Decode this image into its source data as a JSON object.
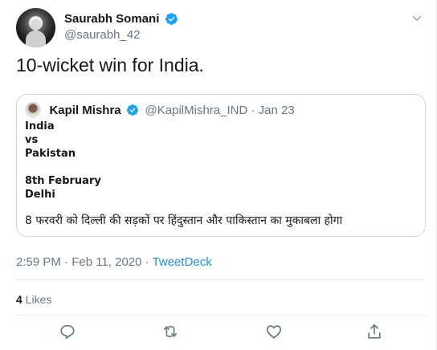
{
  "author": {
    "display_name": "Saurabh Somani",
    "handle": "@saurabh_42",
    "icons": {
      "verified": "verified-badge-icon",
      "more": "chevron-down-icon"
    }
  },
  "tweet": {
    "text": "10-wicket win for India."
  },
  "quoted_tweet": {
    "display_name": "Kapil Mishra",
    "handle_date": "@KapilMishra_IND · Jan 23",
    "lines": [
      "India",
      "vs",
      "Pakistan",
      "",
      "8th February",
      "Delhi"
    ],
    "hindi_line": "8 फरवरी को दिल्ली की सड़कों पर हिंदुस्तान और पाकिस्तान का मुकाबला होगा"
  },
  "meta": {
    "timestamp": "2:59 PM · Feb 11, 2020 · ",
    "source": "TweetDeck"
  },
  "stats": {
    "likes_count": "4",
    "likes_label": " Likes"
  },
  "actions": {
    "reply": "reply-icon",
    "retweet": "retweet-icon",
    "like": "heart-icon",
    "share": "share-icon"
  },
  "colors": {
    "verified_blue": "#1da1f2",
    "link_blue": "#1b95e0",
    "muted_gray": "#657786",
    "text_dark": "#14171a",
    "border": "#ccd6dd"
  }
}
